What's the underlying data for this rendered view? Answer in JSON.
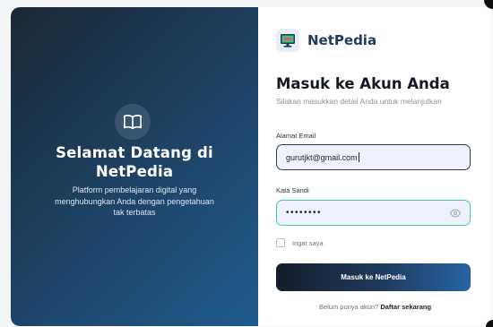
{
  "left_panel": {
    "icon": "book-open-icon",
    "title_line1": "Selamat Datang di",
    "title_line2": "NetPedia",
    "description": "Platform pembelajaran digital yang menghubungkan Anda dengan pengetahuan tak terbatas"
  },
  "brand": {
    "logo_icon": "monitor-logo-icon",
    "name": "NetPedia"
  },
  "form": {
    "heading": "Masuk ke Akun Anda",
    "subheading": "Silakan masukkan detail Anda untuk melanjutkan",
    "email_label": "Alamat Email",
    "email_value": "gurutjkt@gmail.com",
    "password_label": "Kata Sandi",
    "password_value": "••••••••",
    "password_toggle_icon": "eye-icon",
    "remember_label": "Ingat saya",
    "submit_label": "Masuk ke NetPedia",
    "register_prompt": "Belum punya akun?",
    "register_link": "Daftar sekarang"
  },
  "colors": {
    "accent": "#1f5a8e",
    "focus_border": "#43c7a8",
    "input_bg": "#ecf1fb"
  }
}
